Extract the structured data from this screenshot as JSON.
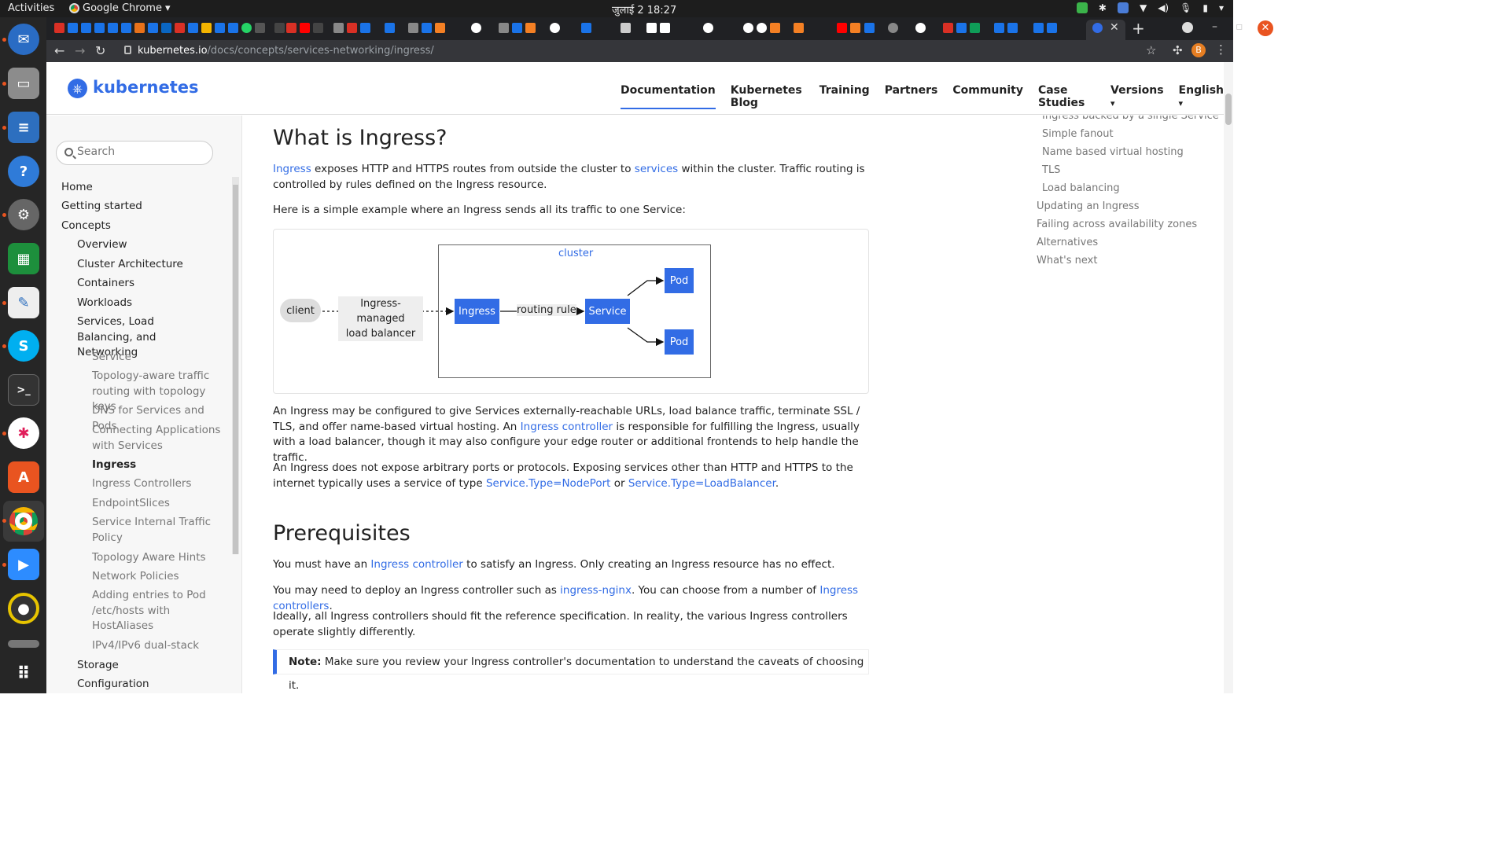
{
  "topbar": {
    "activities": "Activities",
    "app_name": "Google Chrome",
    "clock": "जुलाई 2  18:27"
  },
  "browser": {
    "url_host": "kubernetes.io",
    "url_path": "/docs/concepts/services-networking/ingress/",
    "profile_initial": "B"
  },
  "site": {
    "logo": "kubernetes",
    "nav": [
      "Documentation",
      "Kubernetes Blog",
      "Training",
      "Partners",
      "Community",
      "Case Studies",
      "Versions",
      "English"
    ]
  },
  "sidebar": {
    "search_placeholder": "Search",
    "items": [
      {
        "label": "Home",
        "level": 1
      },
      {
        "label": "Getting started",
        "level": 1
      },
      {
        "label": "Concepts",
        "level": 1
      },
      {
        "label": "Overview",
        "level": 2
      },
      {
        "label": "Cluster Architecture",
        "level": 2
      },
      {
        "label": "Containers",
        "level": 2
      },
      {
        "label": "Workloads",
        "level": 2
      },
      {
        "label": "Services, Load Balancing, and Networking",
        "level": 2
      },
      {
        "label": "Service",
        "level": 3
      },
      {
        "label": "Topology-aware traffic routing with topology keys",
        "level": 3
      },
      {
        "label": "DNS for Services and Pods",
        "level": 3
      },
      {
        "label": "Connecting Applications with Services",
        "level": 3
      },
      {
        "label": "Ingress",
        "level": 3,
        "current": true
      },
      {
        "label": "Ingress Controllers",
        "level": 3
      },
      {
        "label": "EndpointSlices",
        "level": 3
      },
      {
        "label": "Service Internal Traffic Policy",
        "level": 3
      },
      {
        "label": "Topology Aware Hints",
        "level": 3
      },
      {
        "label": "Network Policies",
        "level": 3
      },
      {
        "label": "Adding entries to Pod /etc/hosts with HostAliases",
        "level": 3
      },
      {
        "label": "IPv4/IPv6 dual-stack",
        "level": 3
      },
      {
        "label": "Storage",
        "level": 2
      },
      {
        "label": "Configuration",
        "level": 2
      }
    ]
  },
  "content": {
    "h_what": "What is Ingress?",
    "p1_link1": "Ingress",
    "p1_text1": " exposes HTTP and HTTPS routes from outside the cluster to ",
    "p1_link2": "services",
    "p1_text2": " within the cluster. Traffic routing is controlled by rules defined on the Ingress resource.",
    "p2": "Here is a simple example where an Ingress sends all its traffic to one Service:",
    "diagram": {
      "cluster": "cluster",
      "client": "client",
      "lb_line1": "Ingress-managed",
      "lb_line2": "load balancer",
      "ingress": "Ingress",
      "routing_rule": "routing rule",
      "service": "Service",
      "pod": "Pod"
    },
    "p3_text1": "An Ingress may be configured to give Services externally-reachable URLs, load balance traffic, terminate SSL / TLS, and offer name-based virtual hosting. An ",
    "p3_link": "Ingress controller",
    "p3_text2": " is responsible for fulfilling the Ingress, usually with a load balancer, though it may also configure your edge router or additional frontends to help handle the traffic.",
    "p4_text1": "An Ingress does not expose arbitrary ports or protocols. Exposing services other than HTTP and HTTPS to the internet typically uses a service of type ",
    "p4_link1": "Service.Type=NodePort",
    "p4_text2": " or ",
    "p4_link2": "Service.Type=LoadBalancer",
    "p4_text3": ".",
    "h_prereq": "Prerequisites",
    "p5_text1": "You must have an ",
    "p5_link": "Ingress controller",
    "p5_text2": " to satisfy an Ingress. Only creating an Ingress resource has no effect.",
    "p6_text1": "You may need to deploy an Ingress controller such as ",
    "p6_link1": "ingress-nginx",
    "p6_text2": ". You can choose from a number of ",
    "p6_link2": "Ingress controllers",
    "p6_text3": ".",
    "p7": "Ideally, all Ingress controllers should fit the reference specification. In reality, the various Ingress controllers operate slightly differently.",
    "note_label": "Note:",
    "note_text": " Make sure you review your Ingress controller's documentation to understand the caveats of choosing it."
  },
  "toc": [
    {
      "label": "Ingress backed by a single Service",
      "level": 2
    },
    {
      "label": "Simple fanout",
      "level": 2
    },
    {
      "label": "Name based virtual hosting",
      "level": 2
    },
    {
      "label": "TLS",
      "level": 2
    },
    {
      "label": "Load balancing",
      "level": 2
    },
    {
      "label": "Updating an Ingress",
      "level": 1
    },
    {
      "label": "Failing across availability zones",
      "level": 1
    },
    {
      "label": "Alternatives",
      "level": 1
    },
    {
      "label": "What's next",
      "level": 1
    }
  ],
  "colors": {
    "k8s_blue": "#326ce5",
    "ubuntu_orange": "#e95420"
  }
}
